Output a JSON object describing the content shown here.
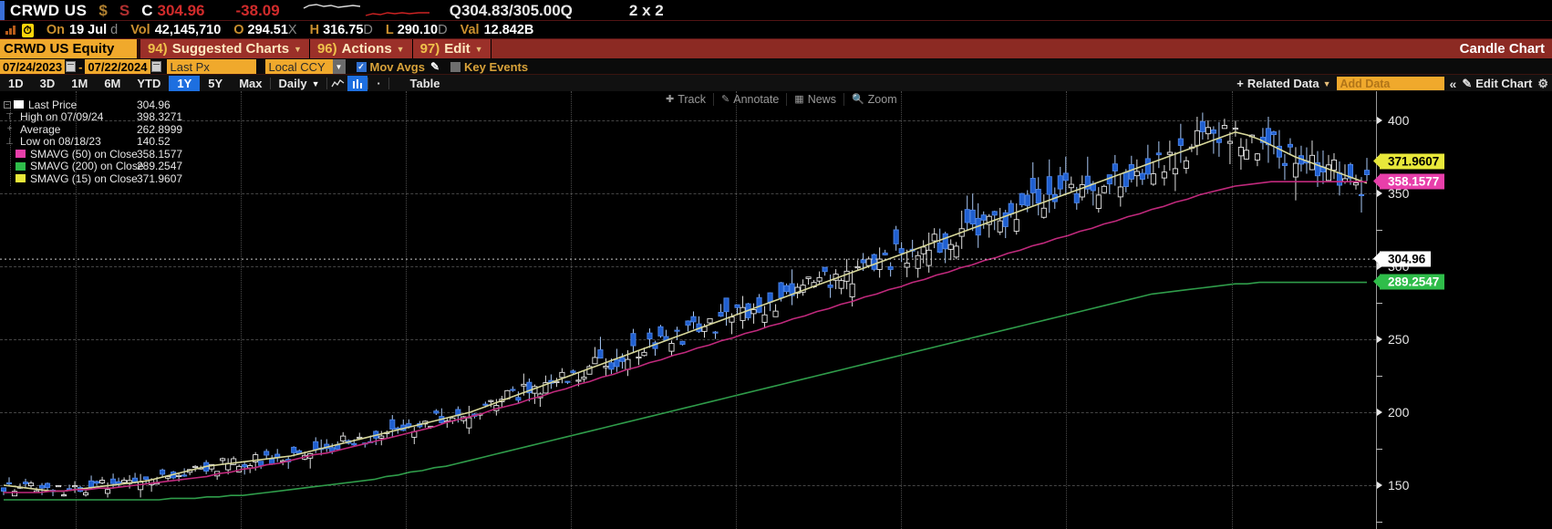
{
  "header": {
    "ticker": "CRWD US",
    "currency_icon": "$",
    "market_flag": "S",
    "close_label": "C",
    "close_price": "304.96",
    "change": "-38.09",
    "quote_left": "Q304.83",
    "quote_sep": "/",
    "quote_right": "305.00Q",
    "size": "2 x 2"
  },
  "stats": {
    "bars_icon": "volume-bars-icon",
    "clock_chip": "clock-icon",
    "on_label": "On",
    "on_date": "19 Jul",
    "on_suffix": "d",
    "vol_label": "Vol",
    "vol_value": "42,145,710",
    "open_label": "O",
    "open_value": "294.51",
    "open_suffix": "X",
    "high_label": "H",
    "high_value": "316.75",
    "high_suffix": "D",
    "low_label": "L",
    "low_value": "290.10",
    "low_suffix": "D",
    "val_label": "Val",
    "val_value": "12.842B"
  },
  "commandbar": {
    "security_field": "CRWD US Equity",
    "menus": [
      {
        "num": "94)",
        "label": "Suggested Charts"
      },
      {
        "num": "96)",
        "label": "Actions"
      },
      {
        "num": "97)",
        "label": "Edit"
      }
    ],
    "chart_type": "Candle Chart"
  },
  "fieldbar": {
    "date_from": "07/24/2023",
    "date_to": "07/22/2024",
    "price_field": "Last Px",
    "currency_field": "Local CCY",
    "mov_avgs_label": "Mov Avgs",
    "mov_avgs_checked": true,
    "key_events_label": "Key Events",
    "key_events_checked": false
  },
  "toolbar": {
    "periods": [
      "1D",
      "3D",
      "1M",
      "6M",
      "YTD",
      "1Y",
      "5Y",
      "Max"
    ],
    "selected_period": "1Y",
    "interval": "Daily",
    "chart_style_line_icon": "line-chart-icon",
    "chart_style_bar_icon": "bar-chart-icon",
    "more_icon": "ellipsis-icon",
    "table_label": "Table",
    "related_data_label": "Related Data",
    "add_data_placeholder": "Add Data",
    "collapse_icon": "chevrons-left-icon",
    "edit_chart_label": "Edit Chart",
    "settings_icon": "gear-icon"
  },
  "chartbar": {
    "track": "Track",
    "annotate": "Annotate",
    "news": "News",
    "zoom": "Zoom"
  },
  "legend": [
    {
      "glyph": "square",
      "color": "#ffffff",
      "name": "Last Price",
      "value": "304.96"
    },
    {
      "glyph": "high",
      "color": "#cccccc",
      "name": "High on 07/09/24",
      "value": "398.3271"
    },
    {
      "glyph": "plus",
      "color": "#cccccc",
      "name": "Average",
      "value": "262.8999"
    },
    {
      "glyph": "low",
      "color": "#cccccc",
      "name": "Low on 08/18/23",
      "value": "140.52"
    },
    {
      "glyph": "square",
      "color": "#e83faa",
      "name": "SMAVG (50)  on Close",
      "value": "358.1577"
    },
    {
      "glyph": "square",
      "color": "#2fbd4a",
      "name": "SMAVG (200)  on Close",
      "value": "289.2547"
    },
    {
      "glyph": "square",
      "color": "#e8e83a",
      "name": "SMAVG (15)  on Close",
      "value": "371.9607"
    }
  ],
  "colors": {
    "accent_amber": "#f0a92c",
    "command_red": "#8c2a23",
    "up_candle": "#1f5fd0",
    "down_candle": "#ffffff",
    "sma15": "#d8d89a",
    "sma50": "#c0297c",
    "sma200": "#2f9c4a",
    "last_price_tag": "#ffffff",
    "select_blue": "#1d6fe0"
  },
  "chart_data": {
    "type": "line",
    "title": "CRWD US Equity - Candle Chart",
    "xlabel": "",
    "ylabel": "",
    "ylim": [
      120,
      420
    ],
    "yticks": [
      150,
      200,
      250,
      300,
      350,
      400
    ],
    "grid": true,
    "legend_position": "top-left",
    "price_tags": [
      {
        "label": "371.9607",
        "bg": "#e8e83a",
        "fg": "#000000",
        "value": 371.9607
      },
      {
        "label": "358.1577",
        "bg": "#e83faa",
        "fg": "#ffffff",
        "value": 358.1577
      },
      {
        "label": "304.96",
        "bg": "#ffffff",
        "fg": "#000000",
        "value": 304.96
      },
      {
        "label": "289.2547",
        "bg": "#2fbd4a",
        "fg": "#ffffff",
        "value": 289.2547
      }
    ],
    "series": [
      {
        "name": "SMAVG (15) on Close",
        "color": "#d8d89a",
        "values": [
          150,
          149,
          148,
          147,
          146,
          146,
          147,
          148,
          149,
          150,
          151,
          152,
          153,
          155,
          157,
          159,
          161,
          163,
          164,
          165,
          166,
          167,
          168,
          169,
          170,
          172,
          174,
          176,
          178,
          180,
          182,
          184,
          186,
          188,
          190,
          192,
          194,
          196,
          198,
          200,
          203,
          206,
          209,
          212,
          215,
          218,
          221,
          224,
          227,
          230,
          233,
          236,
          239,
          242,
          245,
          248,
          251,
          254,
          257,
          260,
          263,
          266,
          269,
          272,
          275,
          278,
          281,
          284,
          287,
          290,
          293,
          296,
          299,
          302,
          305,
          308,
          311,
          314,
          317,
          320,
          323,
          326,
          329,
          332,
          335,
          338,
          341,
          344,
          347,
          350,
          353,
          356,
          359,
          362,
          365,
          368,
          371,
          374,
          377,
          380,
          383,
          386,
          389,
          392,
          390,
          387,
          383,
          379,
          375,
          372,
          369,
          366,
          363,
          360,
          357
        ]
      },
      {
        "name": "SMAVG (50) on Close",
        "color": "#c0297c",
        "values": [
          145,
          145,
          145,
          145,
          146,
          146,
          147,
          147,
          148,
          148,
          149,
          150,
          151,
          152,
          153,
          154,
          155,
          156,
          158,
          159,
          161,
          162,
          164,
          165,
          167,
          169,
          171,
          172,
          174,
          176,
          178,
          180,
          182,
          184,
          186,
          188,
          190,
          193,
          195,
          197,
          199,
          202,
          204,
          206,
          209,
          211,
          214,
          216,
          219,
          221,
          224,
          226,
          229,
          231,
          234,
          236,
          239,
          241,
          244,
          246,
          249,
          251,
          254,
          256,
          259,
          261,
          264,
          266,
          269,
          271,
          274,
          276,
          279,
          281,
          284,
          286,
          289,
          291,
          294,
          296,
          299,
          301,
          304,
          306,
          309,
          311,
          314,
          316,
          319,
          321,
          324,
          326,
          329,
          331,
          334,
          336,
          339,
          341,
          344,
          346,
          349,
          351,
          353,
          355,
          356,
          357,
          358,
          358,
          358,
          358,
          358,
          358,
          358,
          358,
          358
        ]
      },
      {
        "name": "SMAVG (200) on Close",
        "color": "#2f9c4a",
        "values": [
          140,
          140,
          140,
          140,
          140,
          140,
          140,
          140,
          140,
          140,
          140,
          140,
          140,
          140,
          141,
          141,
          141,
          142,
          142,
          143,
          143,
          144,
          145,
          146,
          147,
          148,
          149,
          150,
          151,
          152,
          153,
          154,
          156,
          157,
          159,
          160,
          162,
          163,
          165,
          167,
          169,
          171,
          173,
          175,
          177,
          179,
          181,
          183,
          185,
          187,
          189,
          191,
          193,
          195,
          197,
          199,
          201,
          203,
          205,
          207,
          209,
          211,
          213,
          215,
          217,
          219,
          221,
          223,
          225,
          227,
          229,
          231,
          233,
          235,
          237,
          239,
          241,
          243,
          245,
          247,
          249,
          251,
          253,
          255,
          257,
          259,
          261,
          263,
          265,
          267,
          269,
          271,
          273,
          275,
          277,
          279,
          281,
          282,
          283,
          284,
          285,
          286,
          287,
          288,
          288,
          289,
          289,
          289,
          289,
          289,
          289,
          289,
          289,
          289,
          289
        ]
      }
    ],
    "candles_note": "OHLC daily candles: blue filled = close above open, white hollow = close below open",
    "summary": {
      "period": "07/24/2023 - 07/22/2024",
      "high": 398.3271,
      "high_date": "07/09/24",
      "low": 140.52,
      "low_date": "08/18/23",
      "average": 262.8999,
      "last": 304.96
    }
  }
}
